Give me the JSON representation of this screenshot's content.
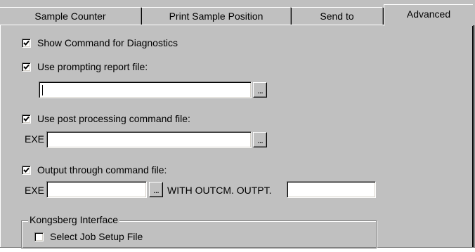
{
  "tabs": [
    {
      "label": "Sample Counter"
    },
    {
      "label": "Print Sample Position"
    },
    {
      "label": "Send to"
    },
    {
      "label": "Advanced",
      "active": true
    }
  ],
  "show_command": {
    "label": "Show Command for Diagnostics",
    "checked": true
  },
  "prompting_report": {
    "label": "Use prompting report file:",
    "checked": true,
    "value": "",
    "browse_label": "..."
  },
  "post_processing": {
    "label": "Use post processing command file:",
    "checked": true,
    "prefix": "EXE",
    "value": "",
    "browse_label": "..."
  },
  "output_through": {
    "label": "Output through command file:",
    "checked": true,
    "prefix": "EXE",
    "value": "",
    "browse_label": "...",
    "with_label": "WITH OUTCM. OUTPT.",
    "outpt_value": ""
  },
  "kongsberg": {
    "group_label": "Kongsberg Interface",
    "select_job": {
      "label": "Select Job Setup File",
      "checked": false
    }
  }
}
